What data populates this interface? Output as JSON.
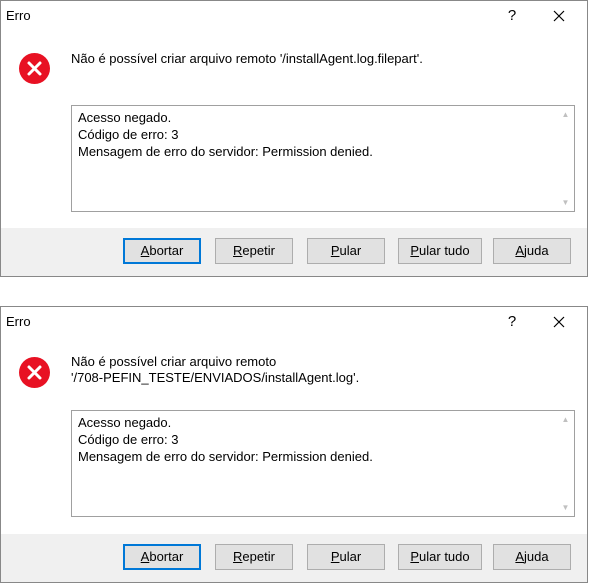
{
  "dialogs": [
    {
      "title": "Erro",
      "help_label": "?",
      "message_lines": [
        "Não é possível criar arquivo remoto '/installAgent.log.filepart'."
      ],
      "details": [
        "Acesso negado.",
        "Código de erro: 3",
        "Mensagem de erro do servidor: Permission denied."
      ],
      "buttons": [
        {
          "hotkey": "A",
          "rest": "bortar",
          "default": true
        },
        {
          "hotkey": "R",
          "rest": "epetir",
          "default": false
        },
        {
          "hotkey": "P",
          "rest": "ular",
          "default": false
        },
        {
          "hotkey": "P",
          "rest": "ular tudo",
          "default": false
        },
        {
          "hotkey": "A",
          "rest": "juda",
          "default": false
        }
      ]
    },
    {
      "title": "Erro",
      "help_label": "?",
      "message_lines": [
        "Não é possível criar arquivo remoto",
        "'/708-PEFIN_TESTE/ENVIADOS/installAgent.log'."
      ],
      "details": [
        "Acesso negado.",
        "Código de erro: 3",
        "Mensagem de erro do servidor: Permission denied."
      ],
      "buttons": [
        {
          "hotkey": "A",
          "rest": "bortar",
          "default": true
        },
        {
          "hotkey": "R",
          "rest": "epetir",
          "default": false
        },
        {
          "hotkey": "P",
          "rest": "ular",
          "default": false
        },
        {
          "hotkey": "P",
          "rest": "ular tudo",
          "default": false
        },
        {
          "hotkey": "A",
          "rest": "juda",
          "default": false
        }
      ]
    }
  ],
  "colors": {
    "error_icon": "#e81123",
    "default_button_border": "#0078d7",
    "button_bar": "#f0f0f0"
  },
  "icons": {
    "error": "error-x-circle",
    "close": "close-x",
    "scroll_up": "chevron-up",
    "scroll_down": "chevron-down"
  }
}
